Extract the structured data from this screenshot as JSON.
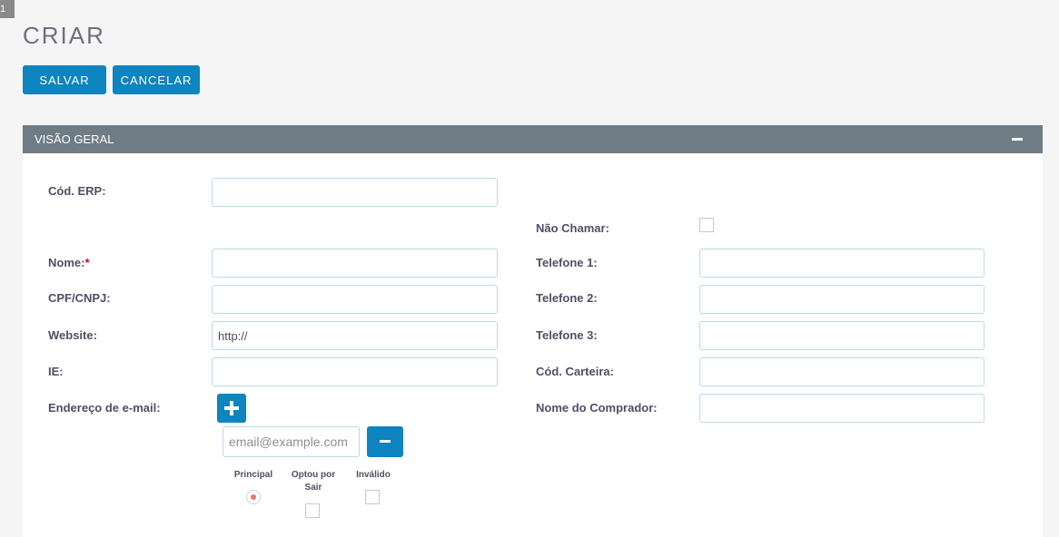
{
  "corner_tag": "1",
  "page": {
    "title": "CRIAR"
  },
  "toolbar": {
    "save_label": "SALVAR",
    "cancel_label": "CANCELAR"
  },
  "panel": {
    "title": "VISÃO GERAL",
    "collapse_icon": "minus-icon"
  },
  "form": {
    "erp_label": "Cód. ERP:",
    "name_label": "Nome:",
    "required_marker": "*",
    "cpf_label": "CPF/CNPJ:",
    "website_label": "Website:",
    "website_value": "http://",
    "ie_label": "IE:",
    "email_label": "Endereço de e-mail:",
    "email_placeholder": "email@example.com",
    "email_options": {
      "principal": "Principal",
      "opted_out_line1": "Optou por",
      "opted_out_line2": "Sair",
      "invalid": "Inválido",
      "principal_selected": true
    },
    "do_not_call_label": "Não Chamar:",
    "phone1_label": "Telefone 1:",
    "phone2_label": "Telefone 2:",
    "phone3_label": "Telefone 3:",
    "wallet_label": "Cód. Carteira:",
    "buyer_label": "Nome do Comprador:"
  },
  "colors": {
    "accent": "#0e84c1",
    "panel_header": "#6f7c86",
    "required": "#d0021b"
  }
}
